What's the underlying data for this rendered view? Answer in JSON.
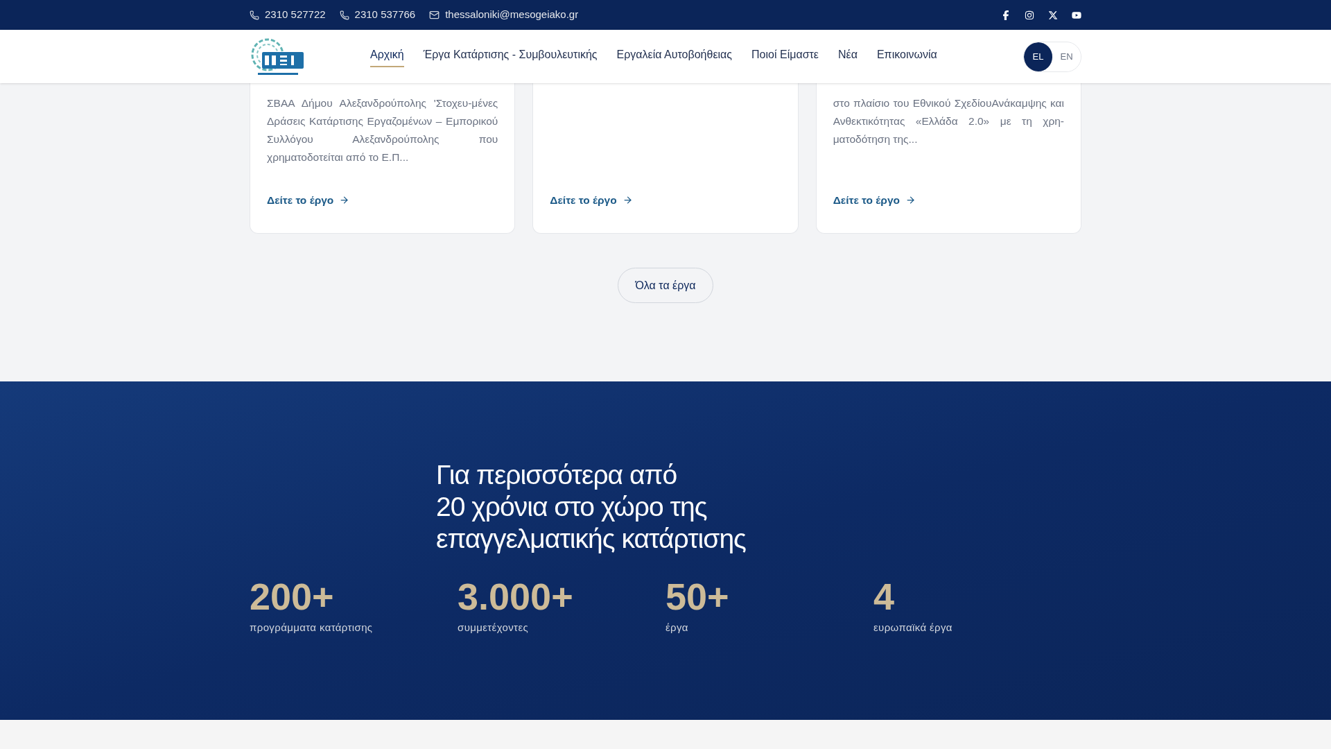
{
  "top_bar": {
    "contacts": [
      {
        "kind": "phone",
        "text": "2310 527722"
      },
      {
        "kind": "phone",
        "text": "2310 537766"
      },
      {
        "kind": "email",
        "text": "thessaloniki@mesogeiako.gr"
      }
    ]
  },
  "nav": {
    "items": [
      {
        "label": "Αρχική",
        "selected": true
      },
      {
        "label": "Έργα Κατάρτισης - Συμβουλευτικής",
        "selected": false
      },
      {
        "label": "Εργαλεία Αυτοβοήθειας",
        "selected": false
      },
      {
        "label": "Ποιοί Είμαστε",
        "selected": false
      },
      {
        "label": "Νέα",
        "selected": false
      },
      {
        "label": "Επικοινωνία",
        "selected": false
      }
    ],
    "languages": [
      {
        "label": "EL",
        "selected": true
      },
      {
        "label": "EN",
        "selected": false
      }
    ]
  },
  "cards": [
    {
      "text": "ΣΒΑΑ Δήμου Αλεξανδρούπολης 'Στοχευ-μένες Δράσεις Κατάρτισης Εργαζομένων – Εμπορικού Συλλόγου Αλεξανδρούπολης που χρηματοδοτείται από το Ε.Π...",
      "link": "Δείτε το έργο"
    },
    {
      "link": "Δείτε το έργο"
    },
    {
      "text": "στο πλαίσιο του Εθνικού ΣχεδίουΑνάκαμψης και Ανθεκτικότητας «Ελλάδα 2.0» με τη χρη-ματοδότηση της...",
      "link": "Δείτε το έργο"
    }
  ],
  "all_projects_button": "Όλα τα έργα",
  "stats_section": {
    "heading": [
      "Για περισσότερα από",
      "20 χρόνια στο χώρο της",
      "επαγγελματικής κατάρτισης"
    ],
    "stats": [
      {
        "value": "200+",
        "label": "προγράμματα κατάρτισης"
      },
      {
        "value": "3.000+",
        "label": "συμμετέχοντες"
      },
      {
        "value": "50+",
        "label": "έργα"
      },
      {
        "value": "4",
        "label": "ευρωπαϊκά έργα"
      }
    ]
  }
}
